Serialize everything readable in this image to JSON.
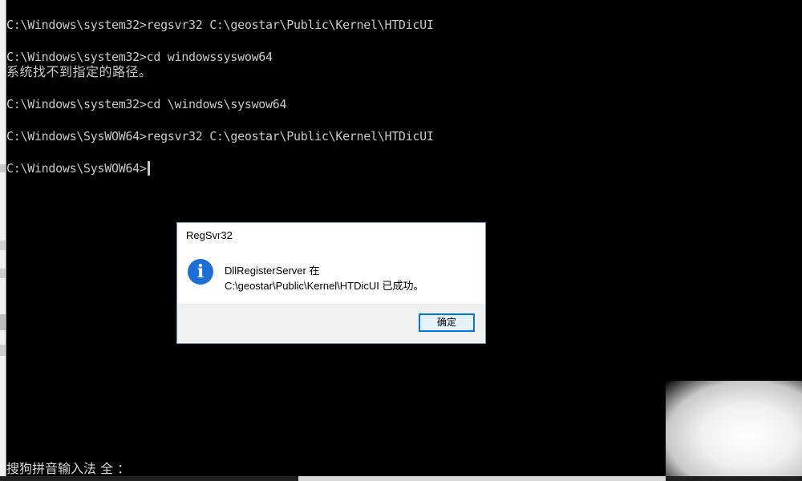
{
  "console": {
    "lines": [
      "C:\\Windows\\system32>regsvr32 C:\\geostar\\Public\\Kernel\\HTDicUI",
      "C:\\Windows\\system32>cd windowssyswow64",
      "系统找不到指定的路径。",
      "C:\\Windows\\system32>cd \\windows\\syswow64",
      "C:\\Windows\\SysWOW64>regsvr32 C:\\geostar\\Public\\Kernel\\HTDicUI",
      "C:\\Windows\\SysWOW64>"
    ],
    "ime_status": "搜狗拼音输入法 全 ："
  },
  "dialog": {
    "title": "RegSvr32",
    "message_line1": "DllRegisterServer 在",
    "message_line2": "C:\\geostar\\Public\\Kernel\\HTDicUI 已成功。",
    "ok_label": "确定",
    "icon": "info-icon"
  },
  "colors": {
    "console_bg": "#000000",
    "console_text": "#c8c8c8",
    "dialog_accent": "#0078d7",
    "info_icon": "#1d6fd6"
  }
}
